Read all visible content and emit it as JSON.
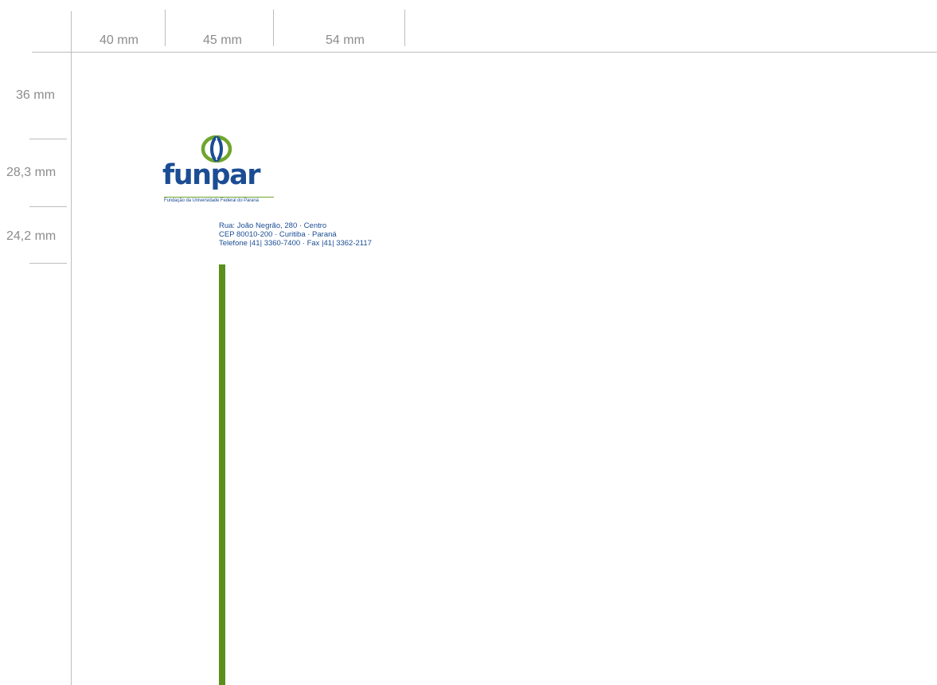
{
  "measurements": {
    "horizontal": [
      "40 mm",
      "45 mm",
      "54 mm"
    ],
    "vertical": [
      "36 mm",
      "28,3 mm",
      "24,2 mm"
    ]
  },
  "logo": {
    "wordmark": "funpar",
    "tagline": "Fundação da Universidade Federal do Paraná",
    "colors": {
      "blue": "#1b4d94",
      "green": "#6fa52c"
    }
  },
  "address": {
    "line1": "Rua: João Negrão, 280  · Centro",
    "line2": "CEP 80010-200 · Curitiba · Paraná",
    "line3": "Telefone |41| 3360-7400  ·  Fax |41| 3362-2117"
  },
  "accent_bar": {
    "color": "#5a8f1c"
  }
}
